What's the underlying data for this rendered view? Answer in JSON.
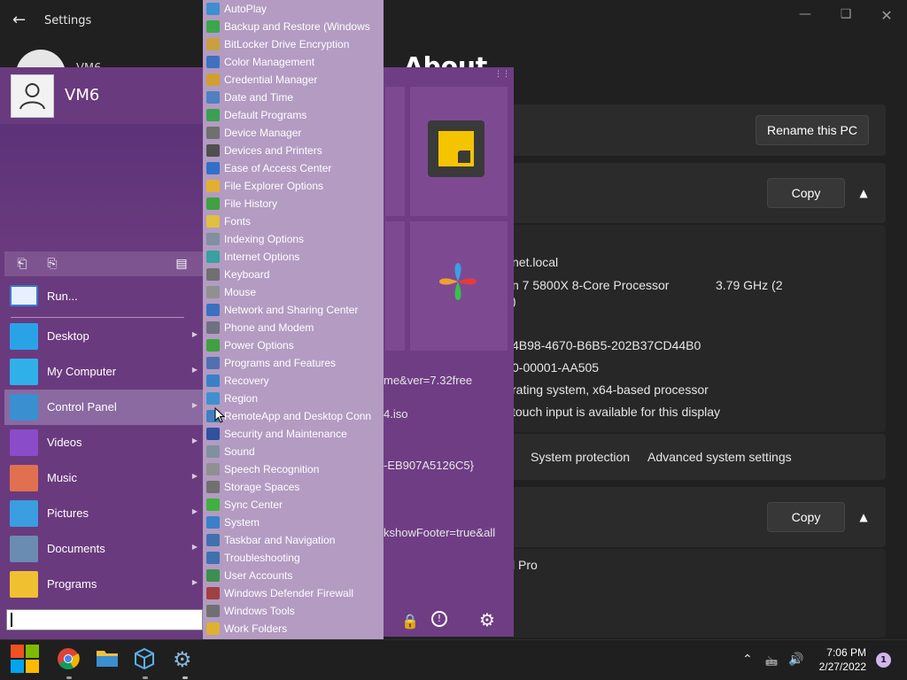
{
  "settings": {
    "window_title": "Settings",
    "page_title": "About",
    "user_fragment": "VM6",
    "rename_button": "Rename this PC",
    "copy_button_1": "Copy",
    "copy_button_2": "Copy",
    "device_lines": [
      "net.local",
      "n 7 5800X 8-Core Processor",
      "3.79 GHz  (2",
      ")",
      "4B98-4670-B6B5-202B37CD44B0",
      "0-00001-AA505",
      "rating system, x64-based processor",
      "touch input is available for this display"
    ],
    "links": {
      "system_protection": "System protection",
      "advanced_settings": "Advanced system settings"
    },
    "windows_edition_fragment": "l Pro",
    "tilepane_text": [
      "me&ver=7.32free",
      "4.iso",
      "-EB907A5126C5}",
      "kshowFooter=true&all"
    ]
  },
  "startmenu": {
    "username": "VM6",
    "run_label": "Run...",
    "items": [
      {
        "label": "Desktop",
        "color": "#2aa3e6"
      },
      {
        "label": "My Computer",
        "color": "#30b0e8"
      },
      {
        "label": "Control Panel",
        "color": "#3a8fd0"
      },
      {
        "label": "Videos",
        "color": "#8a4cc8"
      },
      {
        "label": "Music",
        "color": "#e07050"
      },
      {
        "label": "Pictures",
        "color": "#3a9ee0"
      },
      {
        "label": "Documents",
        "color": "#6a8cb0"
      },
      {
        "label": "Programs",
        "color": "#f0c030"
      }
    ],
    "selected_index": 2
  },
  "cpmenu": {
    "items": [
      {
        "label": "AutoPlay",
        "color": "#3f8fd0"
      },
      {
        "label": "Backup and Restore (Windows",
        "color": "#3aa84a"
      },
      {
        "label": "BitLocker Drive Encryption",
        "color": "#c8a040"
      },
      {
        "label": "Color Management",
        "color": "#4070c0"
      },
      {
        "label": "Credential Manager",
        "color": "#d0a030"
      },
      {
        "label": "Date and Time",
        "color": "#5080c0"
      },
      {
        "label": "Default Programs",
        "color": "#3aa050"
      },
      {
        "label": "Device Manager",
        "color": "#707070"
      },
      {
        "label": "Devices and Printers",
        "color": "#505050"
      },
      {
        "label": "Ease of Access Center",
        "color": "#3070c8"
      },
      {
        "label": "File Explorer Options",
        "color": "#e0b030"
      },
      {
        "label": "File History",
        "color": "#40a040"
      },
      {
        "label": "Fonts",
        "color": "#e0c040"
      },
      {
        "label": "Indexing Options",
        "color": "#8090a0"
      },
      {
        "label": "Internet Options",
        "color": "#3aa0a0"
      },
      {
        "label": "Keyboard",
        "color": "#707070"
      },
      {
        "label": "Mouse",
        "color": "#909090"
      },
      {
        "label": "Network and Sharing Center",
        "color": "#3a70c0"
      },
      {
        "label": "Phone and Modem",
        "color": "#707080"
      },
      {
        "label": "Power Options",
        "color": "#40a040"
      },
      {
        "label": "Programs and Features",
        "color": "#5070b0"
      },
      {
        "label": "Recovery",
        "color": "#3a80c8"
      },
      {
        "label": "Region",
        "color": "#4090d0"
      },
      {
        "label": "RemoteApp and Desktop Conn",
        "color": "#4080c0"
      },
      {
        "label": "Security and Maintenance",
        "color": "#3050a0"
      },
      {
        "label": "Sound",
        "color": "#8090a0"
      },
      {
        "label": "Speech Recognition",
        "color": "#909090"
      },
      {
        "label": "Storage Spaces",
        "color": "#707070"
      },
      {
        "label": "Sync Center",
        "color": "#40b040"
      },
      {
        "label": "System",
        "color": "#3a80c8"
      },
      {
        "label": "Taskbar and Navigation",
        "color": "#4070b0"
      },
      {
        "label": "Troubleshooting",
        "color": "#4070b0"
      },
      {
        "label": "User Accounts",
        "color": "#3a9050"
      },
      {
        "label": "Windows Defender Firewall",
        "color": "#a04040"
      },
      {
        "label": "Windows Tools",
        "color": "#707070"
      },
      {
        "label": "Work Folders",
        "color": "#e0b030"
      }
    ]
  },
  "taskbar": {
    "time": "7:06 PM",
    "date": "2/27/2022",
    "notification_count": "1"
  },
  "colors": {
    "startmenu_bg": "#6a3a7e",
    "cpmenu_bg": "#b39bc2",
    "selected_item": "#8a6aa0",
    "settings_bg": "#202020"
  }
}
